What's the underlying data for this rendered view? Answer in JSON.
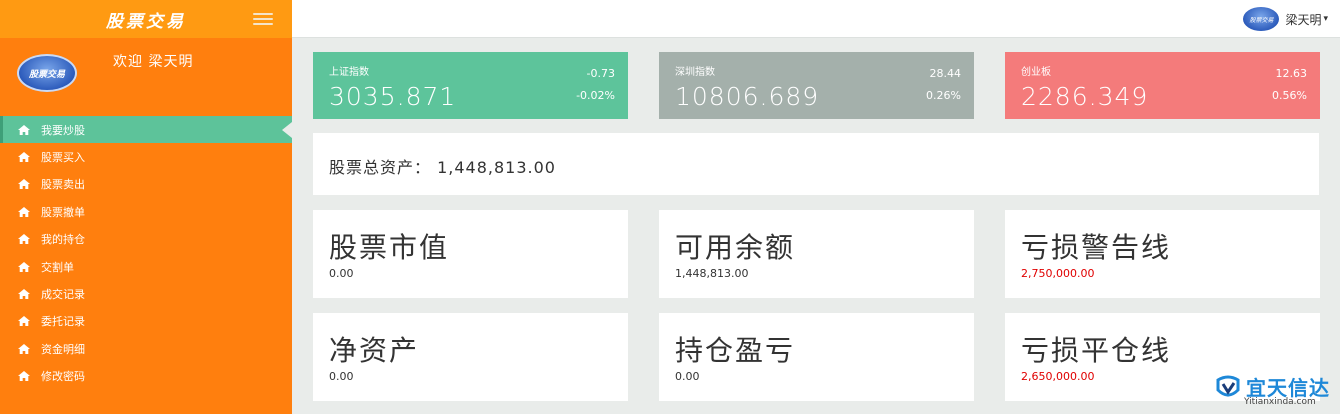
{
  "sidebar": {
    "brand_title": "股票交易",
    "avatar_text": "股票交易",
    "welcome": "欢迎 梁天明",
    "items": [
      {
        "label": "我要炒股",
        "icon": "home-icon",
        "active": true
      },
      {
        "label": "股票买入",
        "icon": "home-icon"
      },
      {
        "label": "股票卖出",
        "icon": "home-icon"
      },
      {
        "label": "股票撤单",
        "icon": "home-icon"
      },
      {
        "label": "我的持仓",
        "icon": "home-icon"
      },
      {
        "label": "交割单",
        "icon": "home-icon"
      },
      {
        "label": "成交记录",
        "icon": "home-icon"
      },
      {
        "label": "委托记录",
        "icon": "home-icon"
      },
      {
        "label": "资金明细",
        "icon": "home-icon"
      },
      {
        "label": "修改密码",
        "icon": "home-icon"
      }
    ]
  },
  "topbar": {
    "avatar_text": "股票交易",
    "username": "梁天明"
  },
  "indices": [
    {
      "name": "上证指数",
      "value": "3035.871",
      "change": "-0.73",
      "pct": "-0.02%",
      "color": "#5dc49b"
    },
    {
      "name": "深圳指数",
      "value": "10806.689",
      "change": "28.44",
      "pct": "0.26%",
      "color": "#a4b0ab"
    },
    {
      "name": "创业板",
      "value": "2286.349",
      "change": "12.63",
      "pct": "0.56%",
      "color": "#f47b7b"
    }
  ],
  "total_assets": {
    "label": "股票总资产：",
    "value": "1,448,813.00"
  },
  "stats": [
    {
      "title": "股票市值",
      "value": "0.00",
      "red": false
    },
    {
      "title": "可用余额",
      "value": "1,448,813.00",
      "red": false
    },
    {
      "title": "亏损警告线",
      "value": "2,750,000.00",
      "red": true
    },
    {
      "title": "净资产",
      "value": "0.00",
      "red": false
    },
    {
      "title": "持仓盈亏",
      "value": "0.00",
      "red": false
    },
    {
      "title": "亏损平仓线",
      "value": "2,650,000.00",
      "red": true
    }
  ],
  "watermark": {
    "text": "宜天信达",
    "url": "Yitianxinda.com"
  },
  "colors": {
    "sidebar": "#ff7f0e",
    "brand": "#ff9a12",
    "active": "#5dc39a",
    "alert": "#e00000"
  }
}
